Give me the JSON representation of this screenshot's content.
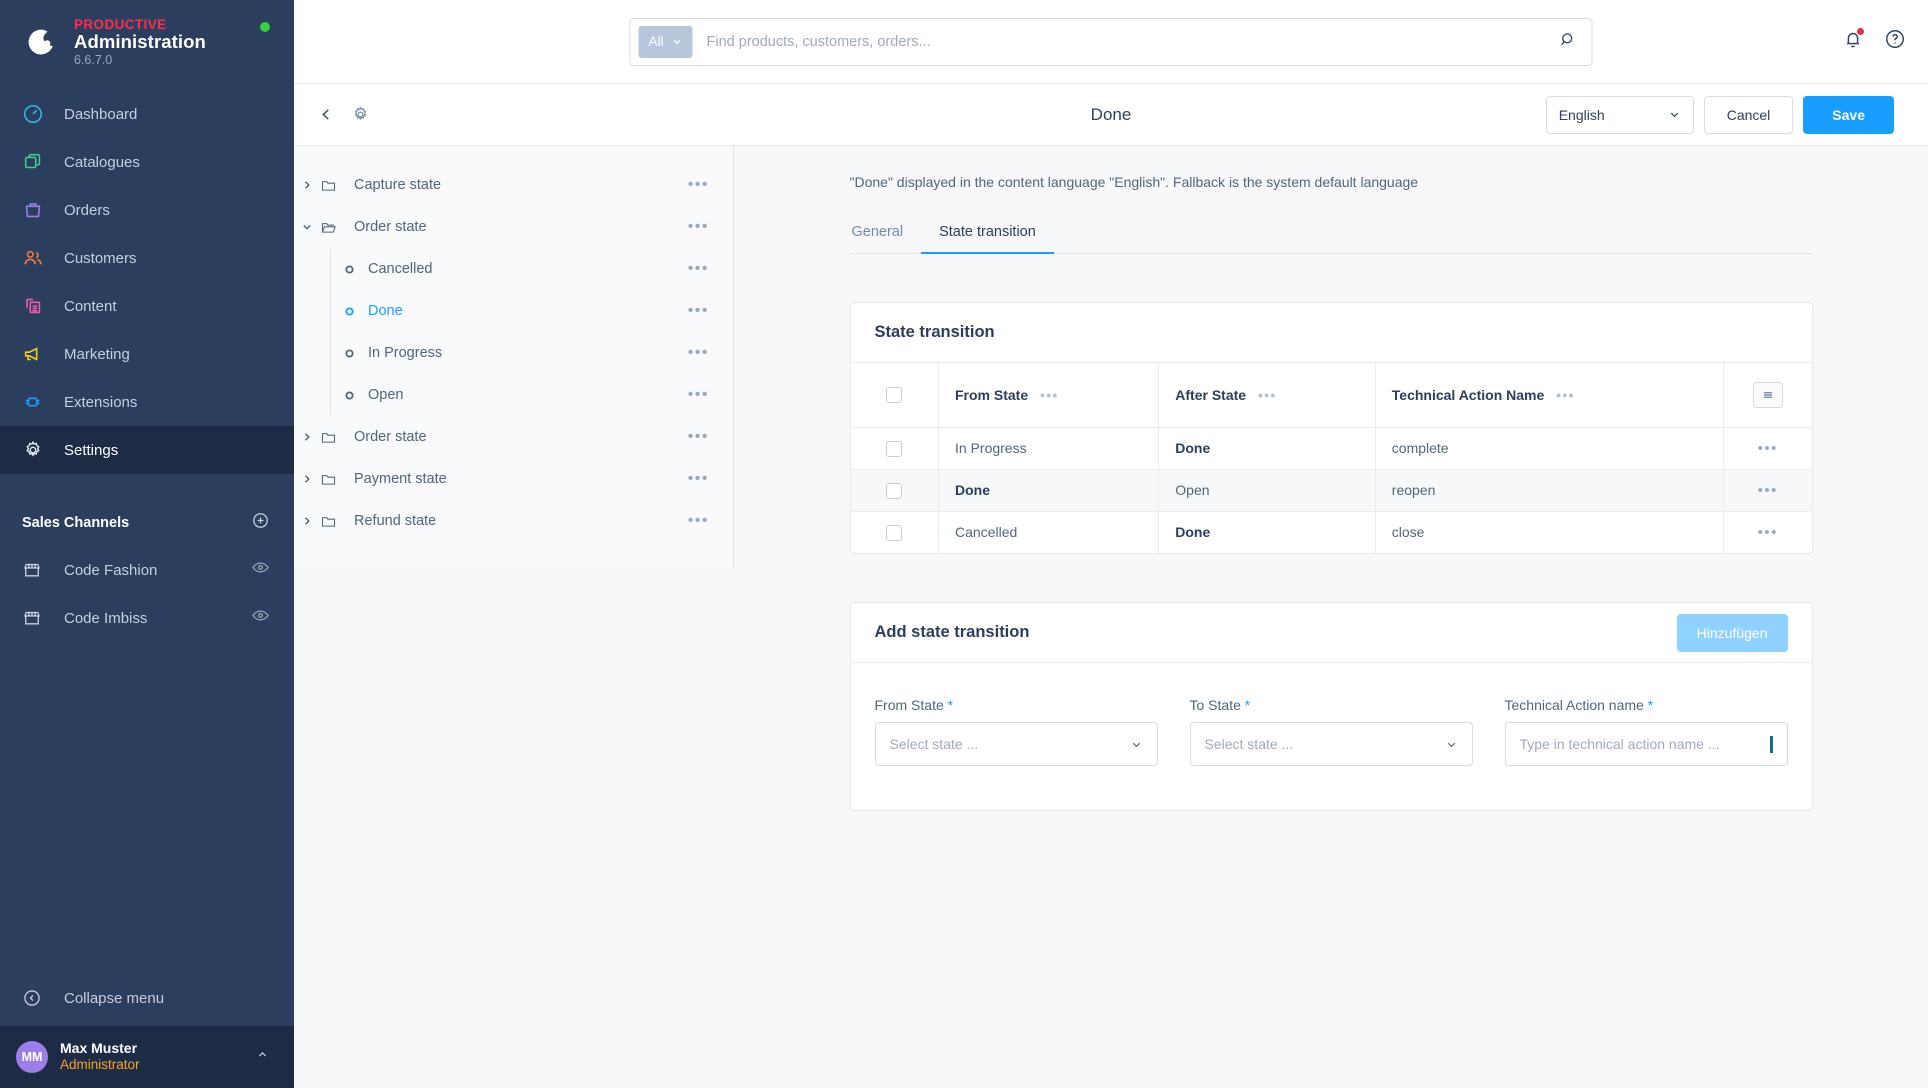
{
  "sidebar": {
    "brand": {
      "product": "PRODUCTIVE",
      "title": "Administration",
      "version": "6.6.7.0"
    },
    "nav": [
      {
        "label": "Dashboard",
        "icon": "dashboard-icon",
        "color": "#37b6e9",
        "active": false
      },
      {
        "label": "Catalogues",
        "icon": "catalogues-icon",
        "color": "#3ecf8e",
        "active": false
      },
      {
        "label": "Orders",
        "icon": "orders-icon",
        "color": "#9b7ee8",
        "active": false
      },
      {
        "label": "Customers",
        "icon": "customers-icon",
        "color": "#f5803e",
        "active": false
      },
      {
        "label": "Content",
        "icon": "content-icon",
        "color": "#ee5fa7",
        "active": false
      },
      {
        "label": "Marketing",
        "icon": "marketing-icon",
        "color": "#f5d312",
        "active": false
      },
      {
        "label": "Extensions",
        "icon": "extensions-icon",
        "color": "#189eff",
        "active": false
      },
      {
        "label": "Settings",
        "icon": "gear-icon",
        "color": "#c6cfdd",
        "active": true
      }
    ],
    "sales_channels": {
      "title": "Sales Channels",
      "add_icon": "plus-circle-icon",
      "items": [
        {
          "label": "Code Fashion",
          "icon": "storefront-icon",
          "action_icon": "eye-icon"
        },
        {
          "label": "Code Imbiss",
          "icon": "storefront-icon",
          "action_icon": "eye-icon"
        }
      ]
    },
    "collapse": {
      "label": "Collapse menu",
      "icon": "collapse-left-icon"
    },
    "user": {
      "initials": "MM",
      "name": "Max Muster",
      "role": "Administrator",
      "chevron": "chevron-up-icon"
    }
  },
  "topbar": {
    "search": {
      "category": "All",
      "placeholder": "Find products, customers, orders...",
      "value": "",
      "search_icon": "search-icon",
      "chevron": "chevron-down-icon"
    },
    "notifications_icon": "bell-icon",
    "has_notification": true,
    "help_icon": "help-circle-icon"
  },
  "smartbar": {
    "back_icon": "chevron-left-icon",
    "settings_icon": "gear-icon",
    "title": "Done",
    "language": "English",
    "cancel_label": "Cancel",
    "save_label": "Save"
  },
  "tree": {
    "items": [
      {
        "label": "Capture state",
        "type": "folder",
        "expanded": false,
        "selected": false,
        "indent": 0
      },
      {
        "label": "Order state",
        "type": "folder-open",
        "expanded": true,
        "selected": false,
        "indent": 0
      },
      {
        "label": "Cancelled",
        "type": "leaf",
        "expanded": false,
        "selected": false,
        "indent": 1
      },
      {
        "label": "Done",
        "type": "leaf",
        "expanded": false,
        "selected": true,
        "indent": 1
      },
      {
        "label": "In Progress",
        "type": "leaf",
        "expanded": false,
        "selected": false,
        "indent": 1
      },
      {
        "label": "Open",
        "type": "leaf",
        "expanded": false,
        "selected": false,
        "indent": 1
      },
      {
        "label": "Order state",
        "type": "folder",
        "expanded": false,
        "selected": false,
        "indent": 0
      },
      {
        "label": "Payment state",
        "type": "folder",
        "expanded": false,
        "selected": false,
        "indent": 0
      },
      {
        "label": "Refund state",
        "type": "folder",
        "expanded": false,
        "selected": false,
        "indent": 0
      }
    ],
    "context_dots": "•••"
  },
  "content": {
    "language_note": "\"Done\" displayed in the content language \"English\". Fallback is the system default language",
    "tabs": [
      {
        "label": "General",
        "active": false
      },
      {
        "label": "State transition",
        "active": true
      }
    ],
    "transition_card": {
      "title": "State transition",
      "columns": [
        "From State",
        "After State",
        "Technical Action Name"
      ],
      "column_dots": "•••",
      "list_settings_icon": "list-settings-icon",
      "rows": [
        {
          "from": "In Progress",
          "from_bold": false,
          "after": "Done",
          "after_bold": true,
          "action": "complete",
          "highlighted": false
        },
        {
          "from": "Done",
          "from_bold": true,
          "after": "Open",
          "after_bold": false,
          "action": "reopen",
          "highlighted": true
        },
        {
          "from": "Cancelled",
          "from_bold": false,
          "after": "Done",
          "after_bold": true,
          "action": "close",
          "highlighted": false
        }
      ],
      "row_dots": "•••"
    },
    "add_card": {
      "title": "Add state transition",
      "add_button": "Hinzufügen",
      "fields": [
        {
          "label": "From State",
          "required": true,
          "placeholder": "Select state ...",
          "type": "select",
          "value": ""
        },
        {
          "label": "To State",
          "required": true,
          "placeholder": "Select state ...",
          "type": "select",
          "value": ""
        },
        {
          "label": "Technical Action name",
          "required": true,
          "placeholder": "Type in technical action name ...",
          "type": "text",
          "value": ""
        }
      ],
      "required_mark": "*"
    }
  },
  "colors": {
    "sidebar_bg": "#2c3e5d",
    "sidebar_active": "#1d2b45",
    "accent": "#189eff",
    "brand_red": "#ff2b4e",
    "status_green": "#37d039",
    "role_orange": "#f5a623"
  }
}
